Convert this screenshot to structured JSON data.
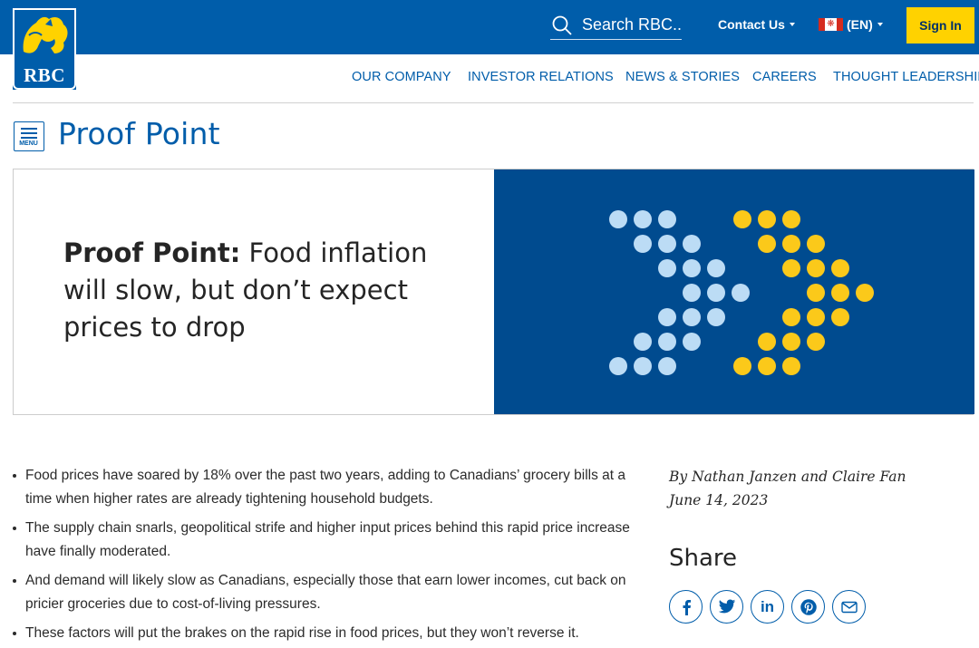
{
  "header": {
    "logo_text": "RBC",
    "search_placeholder": "Search RBC...",
    "contact_label": "Contact Us",
    "language_label": "(EN)",
    "signin_label": "Sign In"
  },
  "nav": {
    "items": [
      {
        "label": "OUR COMPANY"
      },
      {
        "label": "INVESTOR RELATIONS"
      },
      {
        "label": "NEWS & STORIES"
      },
      {
        "label": "CAREERS"
      },
      {
        "label": "THOUGHT LEADERSHIP"
      }
    ]
  },
  "section": {
    "menu_label": "MENU",
    "title": "Proof Point"
  },
  "hero": {
    "title_bold": "Proof Point:",
    "title_rest": " Food inflation will slow, but don’t expect prices to drop"
  },
  "article": {
    "bullets": [
      "Food prices have soared by 18% over the past two years, adding to Canadians’ grocery bills at a time when higher rates are already tightening household budgets.",
      "The supply chain snarls, geopolitical strife and higher input prices behind this rapid price increase have finally moderated.",
      "And demand will likely slow as Canadians, especially those that earn lower incomes, cut back on pricier groceries due to cost-of-living pressures.",
      "These factors will put the brakes on the rapid rise in food prices, but they won’t reverse it."
    ],
    "byline": "By Nathan Janzen and Claire Fan",
    "date": "June 14, 2023"
  },
  "share": {
    "title": "Share",
    "icons": [
      "facebook-icon",
      "twitter-icon",
      "linkedin-icon",
      "pinterest-icon",
      "email-icon"
    ]
  },
  "colors": {
    "brand_blue": "#005daa",
    "hero_blue": "#004b8f",
    "accent_yellow": "#ffd200",
    "dot_light": "#bcdcf5",
    "dot_yellow": "#fbc91a"
  }
}
